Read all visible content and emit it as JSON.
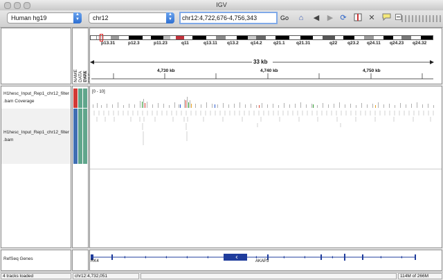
{
  "window": {
    "title": "IGV"
  },
  "toolbar": {
    "genome": "Human hg19",
    "chromosome": "chr12",
    "locus": "chr12:4,722,676-4,756,343",
    "go_label": "Go"
  },
  "ruler": {
    "span_label": "33 kb",
    "ticks": [
      "4,730 kb",
      "4,740 kb",
      "4,750 kb"
    ],
    "bands": [
      "p13.31",
      "p12.3",
      "p11.23",
      "q11",
      "q13.11",
      "q13.2",
      "q14.2",
      "q21.1",
      "q21.31",
      "q22",
      "q23.2",
      "q24.11",
      "q24.23",
      "q24.32"
    ]
  },
  "attributes": {
    "headers": [
      "NAME",
      "DATA TYPE",
      "DATA FILE"
    ]
  },
  "tracks": {
    "coverage_name_1": "H1hesc_Input_Rep1_chr12_filter",
    "coverage_name_2": ".bam Coverage",
    "coverage_range": "[0 - 10]",
    "bam_name_1": "H1hesc_Input_Rep1_chr12_filter",
    "bam_name_2": ".bam"
  },
  "genes": {
    "track_name": "RefSeq Genes",
    "left_gene": "RK4",
    "right_gene": "AKAP3"
  },
  "status": {
    "tracks_loaded": "4 tracks loaded",
    "position": "chr12:4,732,051",
    "memory": "114M of 266M"
  },
  "colors": {
    "accent": "#2e6fd2",
    "gene": "#1f3c9c",
    "attr_red": "#d23a35",
    "attr_teal": "#5fa58b",
    "attr_blue": "#3f6fb3"
  }
}
